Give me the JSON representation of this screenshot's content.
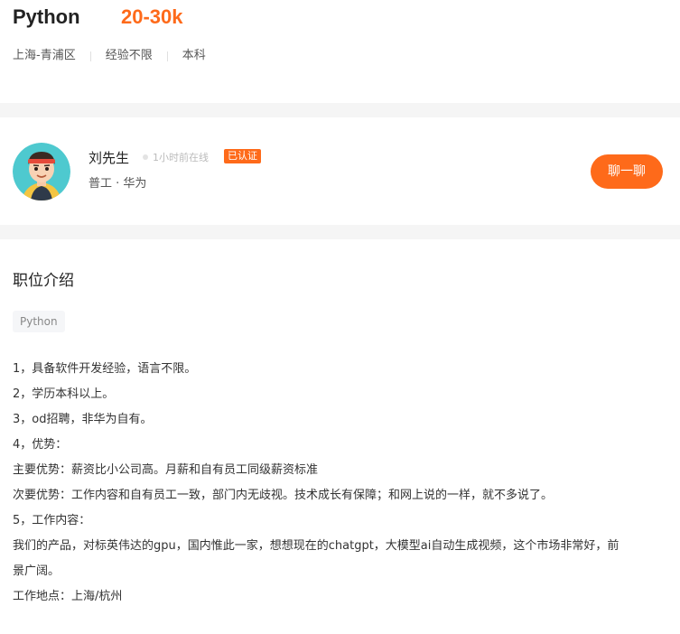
{
  "job": {
    "title": "Python",
    "salary": "20-30k",
    "location": "上海-青浦区",
    "experience": "经验不限",
    "education": "本科"
  },
  "recruiter": {
    "name": "刘先生",
    "online_status": "1小时前在线",
    "verified_badge": "已认证",
    "company_line": "普工 · 华为",
    "chat_button": "聊一聊"
  },
  "description": {
    "section_title": "职位介绍",
    "tag": "Python",
    "lines": [
      "1，具备软件开发经验，语言不限。",
      "2，学历本科以上。",
      "3，od招聘，非华为自有。",
      "4，优势：",
      "主要优势：薪资比小公司高。月薪和自有员工同级薪资标准",
      "次要优势：工作内容和自有员工一致，部门内无歧视。技术成长有保障；和网上说的一样，就不多说了。",
      "5，工作内容：",
      "我们的产品，对标英伟达的gpu，国内惟此一家，想想现在的chatgpt，大模型ai自动生成视频，这个市场非常好，前",
      "景广阔。",
      "工作地点：上海/杭州"
    ]
  },
  "colors": {
    "accent": "#fe6a1a",
    "divider_band": "#f5f5f5",
    "avatar_bg": "#4ec9cf"
  },
  "icons": {
    "avatar": "cartoon-man-avatar",
    "online_dot": "status-dot"
  }
}
